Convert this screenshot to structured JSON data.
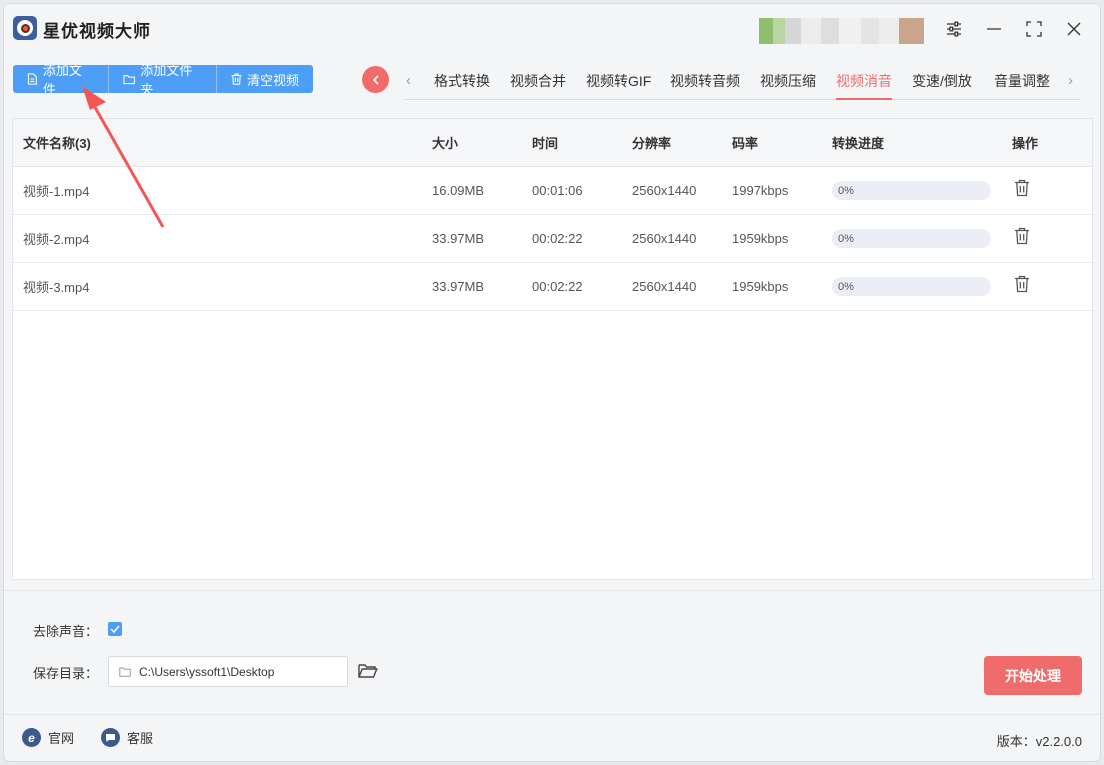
{
  "app": {
    "title": "星优视频大师"
  },
  "toolbar": {
    "add_file": "添加文件",
    "add_folder": "添加文件夹",
    "clear_videos": "清空视频"
  },
  "tabs": [
    {
      "label": "格式转换",
      "active": false
    },
    {
      "label": "视频合并",
      "active": false
    },
    {
      "label": "视频转GIF",
      "active": false
    },
    {
      "label": "视频转音频",
      "active": false
    },
    {
      "label": "视频压缩",
      "active": false
    },
    {
      "label": "视频消音",
      "active": true
    },
    {
      "label": "变速/倒放",
      "active": false
    },
    {
      "label": "音量调整",
      "active": false
    }
  ],
  "table": {
    "headers": {
      "name": "文件名称(3)",
      "size": "大小",
      "time": "时间",
      "resolution": "分辨率",
      "bitrate": "码率",
      "progress": "转换进度",
      "action": "操作"
    },
    "rows": [
      {
        "name": "视频-1.mp4",
        "size": "16.09MB",
        "time": "00:01:06",
        "resolution": "2560x1440",
        "bitrate": "1997kbps",
        "progress": "0%",
        "progress_value": 0
      },
      {
        "name": "视频-2.mp4",
        "size": "33.97MB",
        "time": "00:02:22",
        "resolution": "2560x1440",
        "bitrate": "1959kbps",
        "progress": "0%",
        "progress_value": 0
      },
      {
        "name": "视频-3.mp4",
        "size": "33.97MB",
        "time": "00:02:22",
        "resolution": "2560x1440",
        "bitrate": "1959kbps",
        "progress": "0%",
        "progress_value": 0
      }
    ]
  },
  "settings": {
    "remove_audio_label": "去除声音：",
    "remove_audio_checked": true,
    "save_dir_label": "保存目录：",
    "save_dir_value": "C:\\Users\\yssoft1\\Desktop",
    "start_button": "开始处理"
  },
  "footer": {
    "website": "官网",
    "support": "客服",
    "version": "版本：v2.2.0.0"
  },
  "colors": {
    "primary": "#4d9ef7",
    "accent": "#f06c6b",
    "background": "#f4f5f7"
  }
}
